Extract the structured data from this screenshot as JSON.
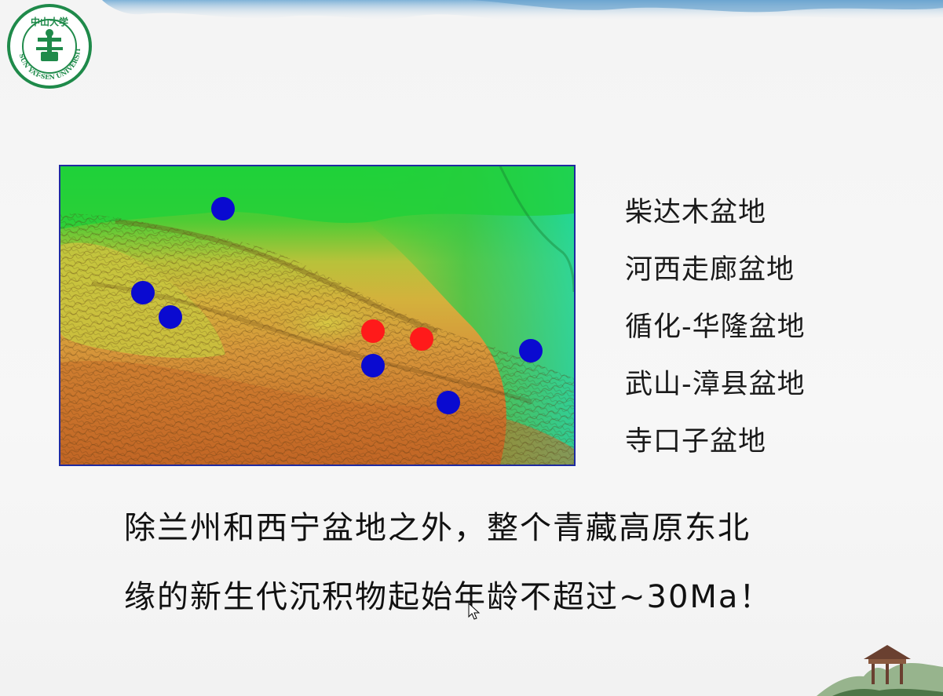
{
  "header": {
    "logo": {
      "icon": "sun-yat-sen-university-seal",
      "text_top": "中山大学",
      "text_ring": "SUN YAT-SEN UNIVERSITY",
      "color": "#1f8a4a"
    }
  },
  "map": {
    "icon": "shaded-relief-elevation-map",
    "dots": {
      "colors": {
        "red": "#ff1a1a",
        "blue": "#0a0ad0"
      }
    }
  },
  "basins": [
    {
      "label": "柴达木盆地"
    },
    {
      "label": "河西走廊盆地"
    },
    {
      "label": "循化-华隆盆地"
    },
    {
      "label": "武山-漳县盆地"
    },
    {
      "label": "寺口子盆地"
    }
  ],
  "conclusion": {
    "line1": "除兰州和西宁盆地之外，整个青藏高原东北",
    "line2": "缘的新生代沉积物起始年龄不超过~30Ma！"
  },
  "decoration": {
    "pavilion_icon": "pavilion-icon",
    "cursor_icon": "mouse-pointer-icon"
  }
}
